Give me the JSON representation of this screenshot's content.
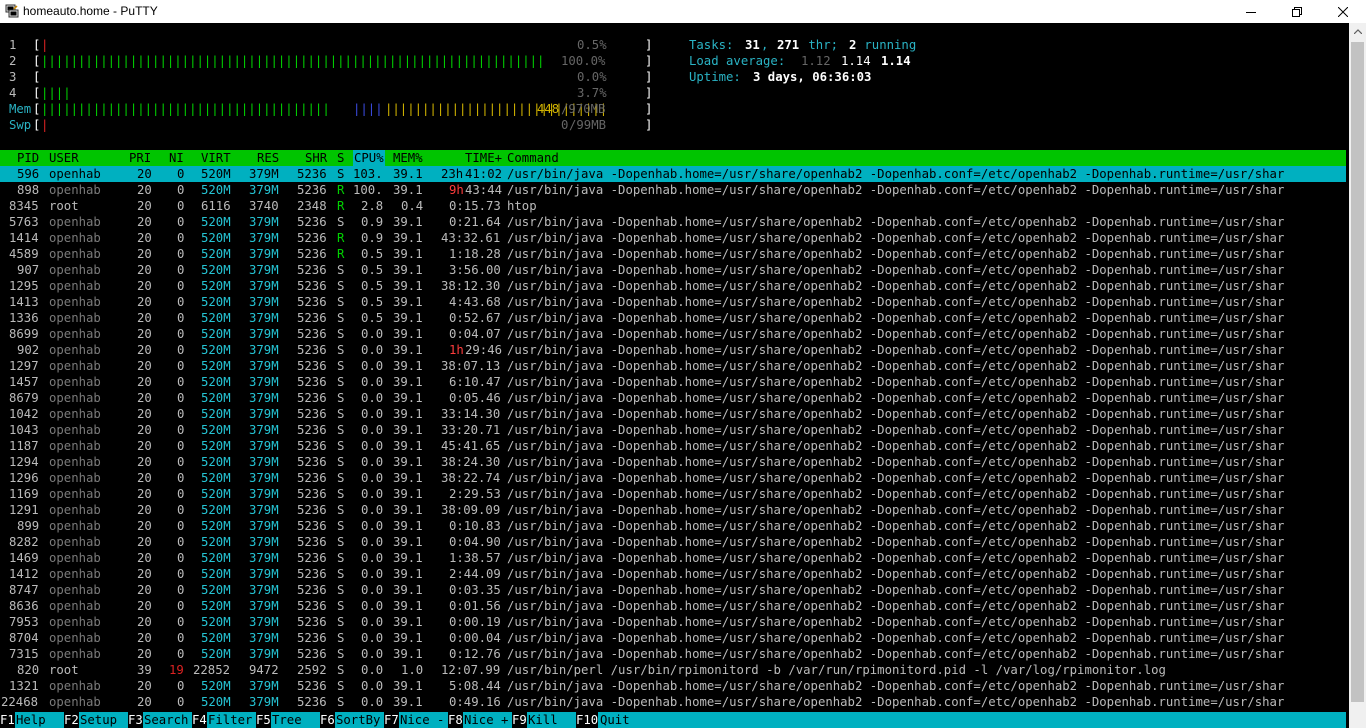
{
  "window": {
    "title": "homeauto.home - PuTTY",
    "icon": "putty-icon"
  },
  "cpu_meters": [
    {
      "label": "1",
      "bar": "|",
      "bar_color": "#d22",
      "pct": "0.5%"
    },
    {
      "label": "2",
      "bar": "||||||||||||||||||||||||||||||||||||||||||||||||||||||||||||||||||||",
      "bar_color": "#00d200",
      "pct": "100.0%"
    },
    {
      "label": "3",
      "bar": "",
      "bar_color": "#00d200",
      "pct": "0.0%"
    },
    {
      "label": "4",
      "bar": "||||",
      "bar_color": "#00d200",
      "pct": "3.7%"
    }
  ],
  "mem": {
    "label": "Mem",
    "bar_g": "|||||||||||||||||||||||||||||||||||||||",
    "bar_b": "||||",
    "bar_y": "||||||||||||||||||||||||||||||",
    "used": "448",
    "total": "/970MB"
  },
  "swp": {
    "label": "Swp",
    "bar": "|",
    "used": "0",
    "total": "/99MB"
  },
  "tasks": {
    "label": "Tasks: ",
    "procs": "31",
    "sep1": ", ",
    "threads": "271",
    "thr": " thr; ",
    "running": "2",
    "run_label": " running"
  },
  "load": {
    "label": "Load average: ",
    "l1": "1.12",
    "l5": "1.14",
    "l15": "1.14"
  },
  "uptime": {
    "label": "Uptime: ",
    "value": "3 days, 06:36:03"
  },
  "columns": [
    "PID",
    "USER",
    "PRI",
    "NI",
    "VIRT",
    "RES",
    "SHR",
    "S",
    "CPU%",
    "MEM%",
    "TIME+",
    "Command"
  ],
  "processes": [
    {
      "pid": "596",
      "user": "openhab",
      "pri": "20",
      "ni": "0",
      "virt": "520M",
      "res": "379M",
      "shr": "5236",
      "s": "S",
      "cpu": "103.",
      "mem": "39.1",
      "time_h": "23h",
      "time": "41:02",
      "cmd": "/usr/bin/java -Dopenhab.home=/usr/share/openhab2 -Dopenhab.conf=/etc/openhab2 -Dopenhab.runtime=/usr/shar",
      "selected": true
    },
    {
      "pid": "898",
      "user": "openhab",
      "pri": "20",
      "ni": "0",
      "virt": "520M",
      "res": "379M",
      "shr": "5236",
      "s": "R",
      "cpu": "100.",
      "mem": "39.1",
      "time_h": "9h",
      "time": "43:44",
      "cmd": "/usr/bin/java -Dopenhab.home=/usr/share/openhab2 -Dopenhab.conf=/etc/openhab2 -Dopenhab.runtime=/usr/shar"
    },
    {
      "pid": "8345",
      "user": "root",
      "pri": "20",
      "ni": "0",
      "virt": "6116",
      "res": "3740",
      "shr": "2348",
      "s": "R",
      "cpu": "2.8",
      "mem": "0.4",
      "time_h": "",
      "time": "0:15.73",
      "cmd": "htop"
    },
    {
      "pid": "5763",
      "user": "openhab",
      "pri": "20",
      "ni": "0",
      "virt": "520M",
      "res": "379M",
      "shr": "5236",
      "s": "S",
      "cpu": "0.9",
      "mem": "39.1",
      "time_h": "",
      "time": "0:21.64",
      "cmd": "/usr/bin/java -Dopenhab.home=/usr/share/openhab2 -Dopenhab.conf=/etc/openhab2 -Dopenhab.runtime=/usr/shar"
    },
    {
      "pid": "1414",
      "user": "openhab",
      "pri": "20",
      "ni": "0",
      "virt": "520M",
      "res": "379M",
      "shr": "5236",
      "s": "R",
      "cpu": "0.9",
      "mem": "39.1",
      "time_h": "",
      "time": "43:32.61",
      "cmd": "/usr/bin/java -Dopenhab.home=/usr/share/openhab2 -Dopenhab.conf=/etc/openhab2 -Dopenhab.runtime=/usr/shar"
    },
    {
      "pid": "4589",
      "user": "openhab",
      "pri": "20",
      "ni": "0",
      "virt": "520M",
      "res": "379M",
      "shr": "5236",
      "s": "R",
      "cpu": "0.5",
      "mem": "39.1",
      "time_h": "",
      "time": "1:18.28",
      "cmd": "/usr/bin/java -Dopenhab.home=/usr/share/openhab2 -Dopenhab.conf=/etc/openhab2 -Dopenhab.runtime=/usr/shar"
    },
    {
      "pid": "907",
      "user": "openhab",
      "pri": "20",
      "ni": "0",
      "virt": "520M",
      "res": "379M",
      "shr": "5236",
      "s": "S",
      "cpu": "0.5",
      "mem": "39.1",
      "time_h": "",
      "time": "3:56.00",
      "cmd": "/usr/bin/java -Dopenhab.home=/usr/share/openhab2 -Dopenhab.conf=/etc/openhab2 -Dopenhab.runtime=/usr/shar"
    },
    {
      "pid": "1295",
      "user": "openhab",
      "pri": "20",
      "ni": "0",
      "virt": "520M",
      "res": "379M",
      "shr": "5236",
      "s": "S",
      "cpu": "0.5",
      "mem": "39.1",
      "time_h": "",
      "time": "38:12.30",
      "cmd": "/usr/bin/java -Dopenhab.home=/usr/share/openhab2 -Dopenhab.conf=/etc/openhab2 -Dopenhab.runtime=/usr/shar"
    },
    {
      "pid": "1413",
      "user": "openhab",
      "pri": "20",
      "ni": "0",
      "virt": "520M",
      "res": "379M",
      "shr": "5236",
      "s": "S",
      "cpu": "0.5",
      "mem": "39.1",
      "time_h": "",
      "time": "4:43.68",
      "cmd": "/usr/bin/java -Dopenhab.home=/usr/share/openhab2 -Dopenhab.conf=/etc/openhab2 -Dopenhab.runtime=/usr/shar"
    },
    {
      "pid": "1336",
      "user": "openhab",
      "pri": "20",
      "ni": "0",
      "virt": "520M",
      "res": "379M",
      "shr": "5236",
      "s": "S",
      "cpu": "0.5",
      "mem": "39.1",
      "time_h": "",
      "time": "0:52.67",
      "cmd": "/usr/bin/java -Dopenhab.home=/usr/share/openhab2 -Dopenhab.conf=/etc/openhab2 -Dopenhab.runtime=/usr/shar"
    },
    {
      "pid": "8699",
      "user": "openhab",
      "pri": "20",
      "ni": "0",
      "virt": "520M",
      "res": "379M",
      "shr": "5236",
      "s": "S",
      "cpu": "0.0",
      "mem": "39.1",
      "time_h": "",
      "time": "0:04.07",
      "cmd": "/usr/bin/java -Dopenhab.home=/usr/share/openhab2 -Dopenhab.conf=/etc/openhab2 -Dopenhab.runtime=/usr/shar"
    },
    {
      "pid": "902",
      "user": "openhab",
      "pri": "20",
      "ni": "0",
      "virt": "520M",
      "res": "379M",
      "shr": "5236",
      "s": "S",
      "cpu": "0.0",
      "mem": "39.1",
      "time_h": "1h",
      "time": "29:46",
      "cmd": "/usr/bin/java -Dopenhab.home=/usr/share/openhab2 -Dopenhab.conf=/etc/openhab2 -Dopenhab.runtime=/usr/shar"
    },
    {
      "pid": "1297",
      "user": "openhab",
      "pri": "20",
      "ni": "0",
      "virt": "520M",
      "res": "379M",
      "shr": "5236",
      "s": "S",
      "cpu": "0.0",
      "mem": "39.1",
      "time_h": "",
      "time": "38:07.13",
      "cmd": "/usr/bin/java -Dopenhab.home=/usr/share/openhab2 -Dopenhab.conf=/etc/openhab2 -Dopenhab.runtime=/usr/shar"
    },
    {
      "pid": "1457",
      "user": "openhab",
      "pri": "20",
      "ni": "0",
      "virt": "520M",
      "res": "379M",
      "shr": "5236",
      "s": "S",
      "cpu": "0.0",
      "mem": "39.1",
      "time_h": "",
      "time": "6:10.47",
      "cmd": "/usr/bin/java -Dopenhab.home=/usr/share/openhab2 -Dopenhab.conf=/etc/openhab2 -Dopenhab.runtime=/usr/shar"
    },
    {
      "pid": "8679",
      "user": "openhab",
      "pri": "20",
      "ni": "0",
      "virt": "520M",
      "res": "379M",
      "shr": "5236",
      "s": "S",
      "cpu": "0.0",
      "mem": "39.1",
      "time_h": "",
      "time": "0:05.46",
      "cmd": "/usr/bin/java -Dopenhab.home=/usr/share/openhab2 -Dopenhab.conf=/etc/openhab2 -Dopenhab.runtime=/usr/shar"
    },
    {
      "pid": "1042",
      "user": "openhab",
      "pri": "20",
      "ni": "0",
      "virt": "520M",
      "res": "379M",
      "shr": "5236",
      "s": "S",
      "cpu": "0.0",
      "mem": "39.1",
      "time_h": "",
      "time": "33:14.30",
      "cmd": "/usr/bin/java -Dopenhab.home=/usr/share/openhab2 -Dopenhab.conf=/etc/openhab2 -Dopenhab.runtime=/usr/shar"
    },
    {
      "pid": "1043",
      "user": "openhab",
      "pri": "20",
      "ni": "0",
      "virt": "520M",
      "res": "379M",
      "shr": "5236",
      "s": "S",
      "cpu": "0.0",
      "mem": "39.1",
      "time_h": "",
      "time": "33:20.71",
      "cmd": "/usr/bin/java -Dopenhab.home=/usr/share/openhab2 -Dopenhab.conf=/etc/openhab2 -Dopenhab.runtime=/usr/shar"
    },
    {
      "pid": "1187",
      "user": "openhab",
      "pri": "20",
      "ni": "0",
      "virt": "520M",
      "res": "379M",
      "shr": "5236",
      "s": "S",
      "cpu": "0.0",
      "mem": "39.1",
      "time_h": "",
      "time": "45:41.65",
      "cmd": "/usr/bin/java -Dopenhab.home=/usr/share/openhab2 -Dopenhab.conf=/etc/openhab2 -Dopenhab.runtime=/usr/shar"
    },
    {
      "pid": "1294",
      "user": "openhab",
      "pri": "20",
      "ni": "0",
      "virt": "520M",
      "res": "379M",
      "shr": "5236",
      "s": "S",
      "cpu": "0.0",
      "mem": "39.1",
      "time_h": "",
      "time": "38:24.30",
      "cmd": "/usr/bin/java -Dopenhab.home=/usr/share/openhab2 -Dopenhab.conf=/etc/openhab2 -Dopenhab.runtime=/usr/shar"
    },
    {
      "pid": "1296",
      "user": "openhab",
      "pri": "20",
      "ni": "0",
      "virt": "520M",
      "res": "379M",
      "shr": "5236",
      "s": "S",
      "cpu": "0.0",
      "mem": "39.1",
      "time_h": "",
      "time": "38:22.74",
      "cmd": "/usr/bin/java -Dopenhab.home=/usr/share/openhab2 -Dopenhab.conf=/etc/openhab2 -Dopenhab.runtime=/usr/shar"
    },
    {
      "pid": "1169",
      "user": "openhab",
      "pri": "20",
      "ni": "0",
      "virt": "520M",
      "res": "379M",
      "shr": "5236",
      "s": "S",
      "cpu": "0.0",
      "mem": "39.1",
      "time_h": "",
      "time": "2:29.53",
      "cmd": "/usr/bin/java -Dopenhab.home=/usr/share/openhab2 -Dopenhab.conf=/etc/openhab2 -Dopenhab.runtime=/usr/shar"
    },
    {
      "pid": "1291",
      "user": "openhab",
      "pri": "20",
      "ni": "0",
      "virt": "520M",
      "res": "379M",
      "shr": "5236",
      "s": "S",
      "cpu": "0.0",
      "mem": "39.1",
      "time_h": "",
      "time": "38:09.09",
      "cmd": "/usr/bin/java -Dopenhab.home=/usr/share/openhab2 -Dopenhab.conf=/etc/openhab2 -Dopenhab.runtime=/usr/shar"
    },
    {
      "pid": "899",
      "user": "openhab",
      "pri": "20",
      "ni": "0",
      "virt": "520M",
      "res": "379M",
      "shr": "5236",
      "s": "S",
      "cpu": "0.0",
      "mem": "39.1",
      "time_h": "",
      "time": "0:10.83",
      "cmd": "/usr/bin/java -Dopenhab.home=/usr/share/openhab2 -Dopenhab.conf=/etc/openhab2 -Dopenhab.runtime=/usr/shar"
    },
    {
      "pid": "8282",
      "user": "openhab",
      "pri": "20",
      "ni": "0",
      "virt": "520M",
      "res": "379M",
      "shr": "5236",
      "s": "S",
      "cpu": "0.0",
      "mem": "39.1",
      "time_h": "",
      "time": "0:04.90",
      "cmd": "/usr/bin/java -Dopenhab.home=/usr/share/openhab2 -Dopenhab.conf=/etc/openhab2 -Dopenhab.runtime=/usr/shar"
    },
    {
      "pid": "1469",
      "user": "openhab",
      "pri": "20",
      "ni": "0",
      "virt": "520M",
      "res": "379M",
      "shr": "5236",
      "s": "S",
      "cpu": "0.0",
      "mem": "39.1",
      "time_h": "",
      "time": "1:38.57",
      "cmd": "/usr/bin/java -Dopenhab.home=/usr/share/openhab2 -Dopenhab.conf=/etc/openhab2 -Dopenhab.runtime=/usr/shar"
    },
    {
      "pid": "1412",
      "user": "openhab",
      "pri": "20",
      "ni": "0",
      "virt": "520M",
      "res": "379M",
      "shr": "5236",
      "s": "S",
      "cpu": "0.0",
      "mem": "39.1",
      "time_h": "",
      "time": "2:44.09",
      "cmd": "/usr/bin/java -Dopenhab.home=/usr/share/openhab2 -Dopenhab.conf=/etc/openhab2 -Dopenhab.runtime=/usr/shar"
    },
    {
      "pid": "8747",
      "user": "openhab",
      "pri": "20",
      "ni": "0",
      "virt": "520M",
      "res": "379M",
      "shr": "5236",
      "s": "S",
      "cpu": "0.0",
      "mem": "39.1",
      "time_h": "",
      "time": "0:03.35",
      "cmd": "/usr/bin/java -Dopenhab.home=/usr/share/openhab2 -Dopenhab.conf=/etc/openhab2 -Dopenhab.runtime=/usr/shar"
    },
    {
      "pid": "8636",
      "user": "openhab",
      "pri": "20",
      "ni": "0",
      "virt": "520M",
      "res": "379M",
      "shr": "5236",
      "s": "S",
      "cpu": "0.0",
      "mem": "39.1",
      "time_h": "",
      "time": "0:01.56",
      "cmd": "/usr/bin/java -Dopenhab.home=/usr/share/openhab2 -Dopenhab.conf=/etc/openhab2 -Dopenhab.runtime=/usr/shar"
    },
    {
      "pid": "7953",
      "user": "openhab",
      "pri": "20",
      "ni": "0",
      "virt": "520M",
      "res": "379M",
      "shr": "5236",
      "s": "S",
      "cpu": "0.0",
      "mem": "39.1",
      "time_h": "",
      "time": "0:00.19",
      "cmd": "/usr/bin/java -Dopenhab.home=/usr/share/openhab2 -Dopenhab.conf=/etc/openhab2 -Dopenhab.runtime=/usr/shar"
    },
    {
      "pid": "8704",
      "user": "openhab",
      "pri": "20",
      "ni": "0",
      "virt": "520M",
      "res": "379M",
      "shr": "5236",
      "s": "S",
      "cpu": "0.0",
      "mem": "39.1",
      "time_h": "",
      "time": "0:00.04",
      "cmd": "/usr/bin/java -Dopenhab.home=/usr/share/openhab2 -Dopenhab.conf=/etc/openhab2 -Dopenhab.runtime=/usr/shar"
    },
    {
      "pid": "7315",
      "user": "openhab",
      "pri": "20",
      "ni": "0",
      "virt": "520M",
      "res": "379M",
      "shr": "5236",
      "s": "S",
      "cpu": "0.0",
      "mem": "39.1",
      "time_h": "",
      "time": "0:12.76",
      "cmd": "/usr/bin/java -Dopenhab.home=/usr/share/openhab2 -Dopenhab.conf=/etc/openhab2 -Dopenhab.runtime=/usr/shar"
    },
    {
      "pid": "820",
      "user": "root",
      "pri": "39",
      "ni": "19",
      "virt": "22852",
      "res": "9472",
      "shr": "2592",
      "s": "S",
      "cpu": "0.0",
      "mem": "1.0",
      "time_h": "",
      "time": "12:07.99",
      "cmd": "/usr/bin/perl /usr/bin/rpimonitord -b /var/run/rpimonitord.pid -l /var/log/rpimonitor.log"
    },
    {
      "pid": "1321",
      "user": "openhab",
      "pri": "20",
      "ni": "0",
      "virt": "520M",
      "res": "379M",
      "shr": "5236",
      "s": "S",
      "cpu": "0.0",
      "mem": "39.1",
      "time_h": "",
      "time": "5:08.44",
      "cmd": "/usr/bin/java -Dopenhab.home=/usr/share/openhab2 -Dopenhab.conf=/etc/openhab2 -Dopenhab.runtime=/usr/shar"
    },
    {
      "pid": "22468",
      "user": "openhab",
      "pri": "20",
      "ni": "0",
      "virt": "520M",
      "res": "379M",
      "shr": "5236",
      "s": "S",
      "cpu": "0.0",
      "mem": "39.1",
      "time_h": "",
      "time": "0:49.16",
      "cmd": "/usr/bin/java -Dopenhab.home=/usr/share/openhab2 -Dopenhab.conf=/etc/openhab2 -Dopenhab.runtime=/usr/shar"
    }
  ],
  "function_keys": [
    {
      "key": "F1",
      "label": "Help  "
    },
    {
      "key": "F2",
      "label": "Setup "
    },
    {
      "key": "F3",
      "label": "Search"
    },
    {
      "key": "F4",
      "label": "Filter"
    },
    {
      "key": "F5",
      "label": "Tree  "
    },
    {
      "key": "F6",
      "label": "SortBy"
    },
    {
      "key": "F7",
      "label": "Nice -"
    },
    {
      "key": "F8",
      "label": "Nice +"
    },
    {
      "key": "F9",
      "label": "Kill  "
    },
    {
      "key": "F10",
      "label": "Quit"
    }
  ]
}
